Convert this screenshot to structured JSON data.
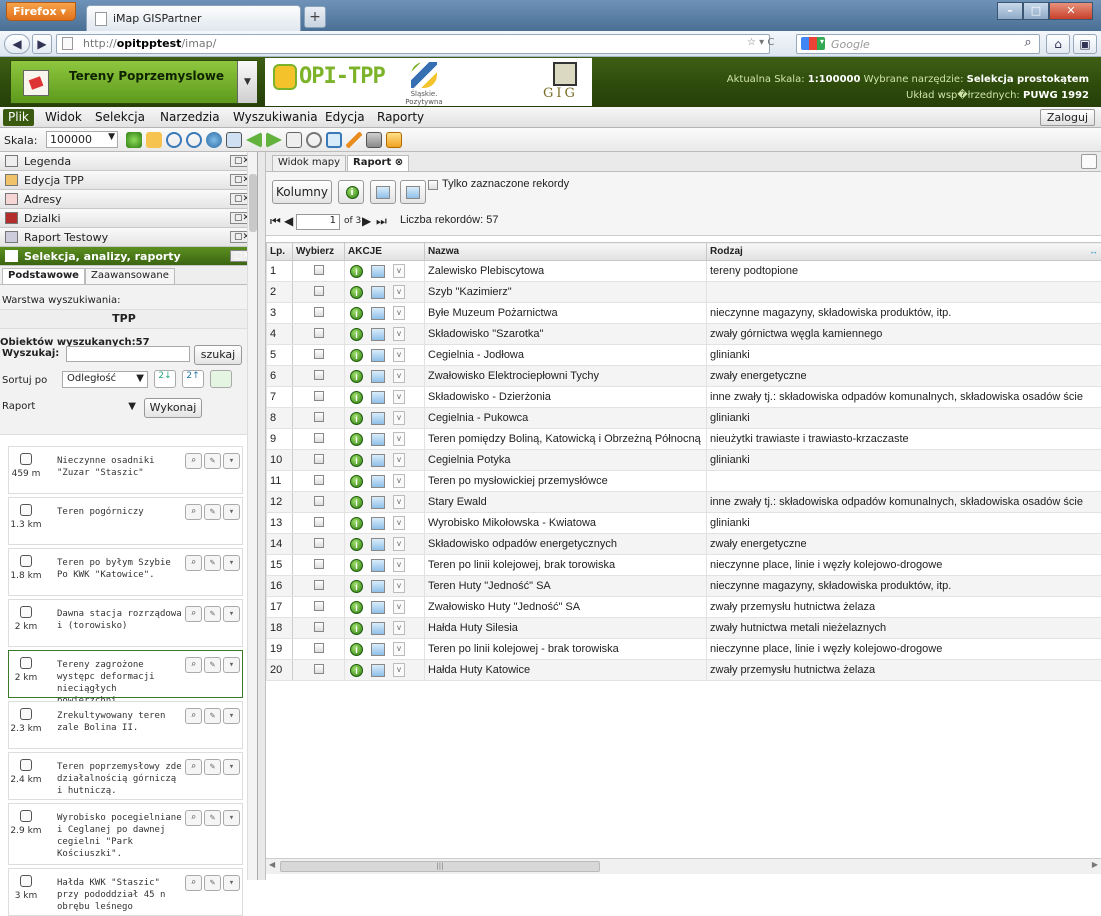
{
  "browser": {
    "menu_label": "Firefox",
    "tab_title": "iMap GISPartner",
    "new_tab": "+",
    "url_prefix": "http://",
    "url_host": "opitpptest",
    "url_path": "/imap/",
    "search_placeholder": "Google",
    "back": "◀",
    "minimize": "–",
    "maximize": "□",
    "close": "✕"
  },
  "header": {
    "layer_name": "Tereny Poprzemyslowe",
    "logo_opi": "OPI-TPP",
    "logo_sl_line1": "Śląskie.",
    "logo_sl_line2": "Pozytywna energia",
    "logo_gig": "GIG",
    "scale_label": "Aktualna Skala:",
    "scale_value": "1:100000",
    "tool_label": "Wybrane narzędzie:",
    "tool_value": "Selekcja prostokątem",
    "coord_label": "Układ wsp�łrzednych:",
    "coord_value": "PUWG 1992"
  },
  "menu": [
    "Plik",
    "Widok",
    "Selekcja",
    "Narzedzia",
    "Wyszukiwania",
    "Edycja",
    "Raporty"
  ],
  "login_label": "Zaloguj",
  "toolbar": {
    "scale_label": "Skala:",
    "scale_value": "100000"
  },
  "accordion": [
    {
      "label": "Legenda",
      "icon": "legend-icon"
    },
    {
      "label": "Edycja TPP",
      "icon": "edit-icon"
    },
    {
      "label": "Adresy",
      "icon": "address-icon"
    },
    {
      "label": "Dzialki",
      "icon": "parcel-icon"
    },
    {
      "label": "Raport Testowy",
      "icon": "report-icon"
    },
    {
      "label": "Selekcja, analizy, raporty",
      "icon": "selection-icon"
    }
  ],
  "subtabs": [
    "Podstawowe",
    "Zaawansowane"
  ],
  "search": {
    "layer_label": "Warstwa wyszukiwania:",
    "layer_value": "TPP",
    "found_label": "Obiektów wyszukanych:",
    "found_count": "57",
    "find_label": "Wyszukaj:",
    "find_button": "szukaj",
    "sort_label": "Sortuj po",
    "sort_value": "Odległość",
    "report_value": "Raport",
    "run_button": "Wykonaj"
  },
  "results": [
    {
      "dist": "459 m",
      "text": "Nieczynne osadniki \"Zuzar \"Staszic\""
    },
    {
      "dist": "1.3 km",
      "text": "Teren pogórniczy"
    },
    {
      "dist": "1.8 km",
      "text": "Teren po byłym Szybie Po KWK \"Katowice\"."
    },
    {
      "dist": "2 km",
      "text": "Dawna stacja rozrządowa i (torowisko)"
    },
    {
      "dist": "2 km",
      "text": "Tereny zagrożone występc deformacji nieciągłych powierzchni."
    },
    {
      "dist": "2.3 km",
      "text": "Zrekultywowany teren zale Bolina II."
    },
    {
      "dist": "2.4 km",
      "text": "Teren poprzemysłowy zde działalnością górniczą i hutniczą."
    },
    {
      "dist": "2.9 km",
      "text": "Wyrobisko pocegielniane i Ceglanej po dawnej cegielni \"Park Kościuszki\"."
    },
    {
      "dist": "3 km",
      "text": "Hałda KWK \"Staszic\" przy pododdział 45 n obrębu leśnego"
    }
  ],
  "right_tabs": [
    "Widok mapy",
    "Raport"
  ],
  "report": {
    "columns_button": "Kolumny",
    "only_selected": "Tylko zaznaczone rekordy",
    "page_value": "1",
    "page_total": "of 3",
    "records_label": "Liczba rekordów: 57"
  },
  "table": {
    "headers": [
      "Lp.",
      "Wybierz",
      "AKCJE",
      "Nazwa",
      "Rodzaj"
    ],
    "rows": [
      [
        "1",
        "Zalewisko Plebiscytowa",
        "tereny podtopione"
      ],
      [
        "2",
        "Szyb \"Kazimierz\"",
        ""
      ],
      [
        "3",
        "Byłe Muzeum Pożarnictwa",
        "nieczynne magazyny, składowiska produktów, itp."
      ],
      [
        "4",
        "Składowisko \"Szarotka\"",
        "zwały górnictwa węgla kamiennego"
      ],
      [
        "5",
        "Cegielnia - Jodłowa",
        "glinianki"
      ],
      [
        "6",
        "Zwałowisko Elektrociepłowni Tychy",
        "zwały energetyczne"
      ],
      [
        "7",
        "Składowisko - Dzierżonia",
        "inne zwały tj.: składowiska odpadów komunalnych, składowiska osadów ście"
      ],
      [
        "8",
        "Cegielnia - Pukowca",
        "glinianki"
      ],
      [
        "9",
        "Teren pomiędzy Boliną, Katowicką i Obrzeżną Północną",
        "nieużytki trawiaste i trawiasto-krzaczaste"
      ],
      [
        "10",
        "Cegielnia Potyka",
        "glinianki"
      ],
      [
        "11",
        "Teren po mysłowickiej przemysłówce",
        ""
      ],
      [
        "12",
        "Stary Ewald",
        "inne zwały tj.: składowiska odpadów komunalnych, składowiska osadów ście"
      ],
      [
        "13",
        "Wyrobisko Mikołowska - Kwiatowa",
        "glinianki"
      ],
      [
        "14",
        "Składowisko odpadów energetycznych",
        "zwały energetyczne"
      ],
      [
        "15",
        "Teren po linii kolejowej, brak torowiska",
        "nieczynne place, linie i węzły kolejowo-drogowe"
      ],
      [
        "16",
        "Teren Huty \"Jedność\" SA",
        "nieczynne magazyny, składowiska produktów, itp."
      ],
      [
        "17",
        "Zwałowisko Huty \"Jedność\" SA",
        "zwały przemysłu hutnictwa żelaza"
      ],
      [
        "18",
        "Hałda Huty Silesia",
        "zwały hutnictwa metali nieżelaznych"
      ],
      [
        "19",
        "Teren po linii kolejowej - brak torowiska",
        "nieczynne place, linie i węzły kolejowo-drogowe"
      ],
      [
        "20",
        "Hałda Huty Katowice",
        "zwały przemysłu hutnictwa żelaza"
      ]
    ]
  },
  "colors": {
    "header_green": "#2d4a0b",
    "accent_green": "#5d9a1d",
    "active_menu": "#3a5b0f"
  }
}
